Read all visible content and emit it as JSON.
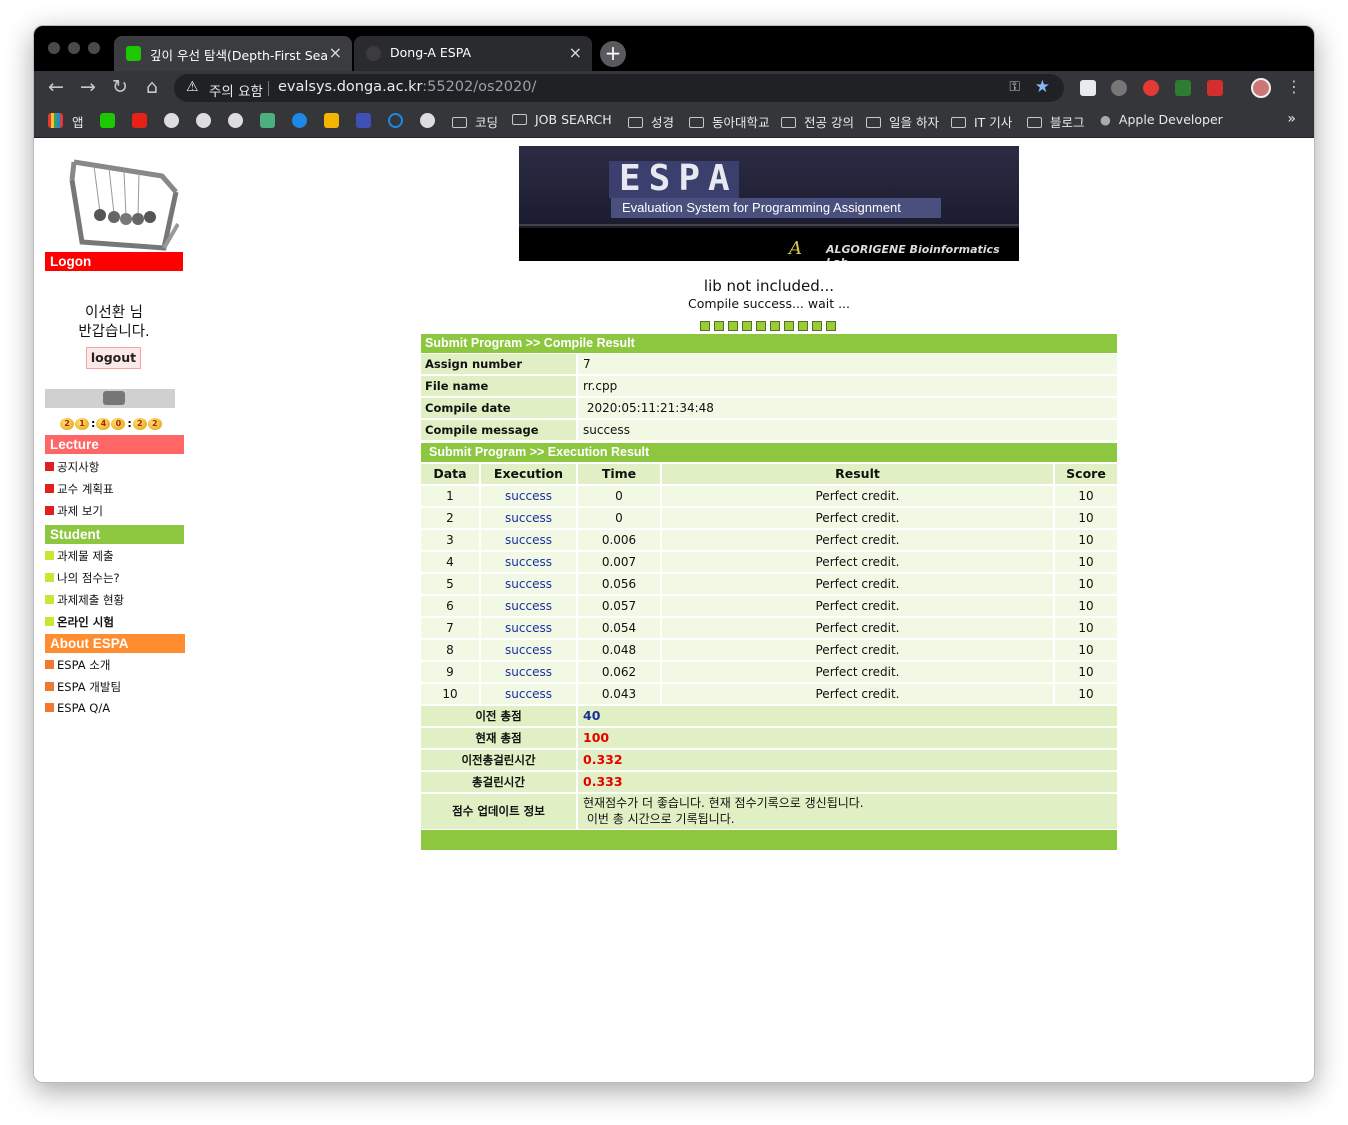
{
  "browser": {
    "tabs": [
      {
        "title": "깊이 우선 탐색(Depth-First Sear...",
        "active": false,
        "favicon": "blog-icon"
      },
      {
        "title": "Dong-A ESPA",
        "active": true,
        "favicon": "globe-icon"
      }
    ],
    "security_label": "주의 요함",
    "url_host": "evalsys.donga.ac.kr",
    "url_rest": ":55202/os2020/",
    "bookmarks": [
      {
        "label": "앱"
      },
      {
        "label": "코딩"
      },
      {
        "label": "JOB SEARCH"
      },
      {
        "label": "성경"
      },
      {
        "label": "동아대학교"
      },
      {
        "label": "전공 강의"
      },
      {
        "label": "일을 하자"
      },
      {
        "label": "IT 기사"
      },
      {
        "label": "블로그"
      },
      {
        "label": "Apple Developer"
      }
    ],
    "more": "»"
  },
  "sidebar": {
    "logon": "Logon",
    "user_name": "이선환 님",
    "welcome": "반갑습니다.",
    "logout": "logout",
    "counter": [
      "2",
      "1",
      "4",
      "0",
      "2",
      "2"
    ],
    "lecture_title": "Lecture",
    "lecture_items": [
      "공지사항",
      "교수 계획표",
      "과제 보기"
    ],
    "student_title": "Student",
    "student_items": [
      "과제물 제출",
      "나의 점수는?",
      "과제제출 현황",
      "온라인 시험"
    ],
    "about_title": "About ESPA",
    "about_items": [
      "ESPA 소개",
      "ESPA 개발팀",
      "ESPA Q/A"
    ],
    "colors": {
      "lecture": "#ff6666",
      "student": "#8dc63f",
      "about": "#ff8c2e",
      "logon": "#ff0000"
    }
  },
  "banner": {
    "title": "ESPA",
    "subtitle": "Evaluation System for Programming Assignment",
    "lab": "ALGORIGENE Bioinformatics Lab"
  },
  "status": {
    "line1": "lib not included...",
    "line2": "Compile success... wait ..."
  },
  "compile": {
    "header": "Submit Program >> Compile Result",
    "rows": [
      {
        "key": "Assign number",
        "value": "7"
      },
      {
        "key": "File name",
        "value": "rr.cpp"
      },
      {
        "key": "Compile date",
        "value": " 2020:05:11:21:34:48"
      },
      {
        "key": "Compile message",
        "value": "success"
      }
    ]
  },
  "execution": {
    "header": "Submit Program >> Execution Result",
    "columns": [
      "Data",
      "Execution",
      "Time",
      "Result",
      "Score"
    ],
    "rows": [
      [
        "1",
        "success",
        "0",
        "Perfect credit.",
        "10"
      ],
      [
        "2",
        "success",
        "0",
        "Perfect credit.",
        "10"
      ],
      [
        "3",
        "success",
        "0.006",
        "Perfect credit.",
        "10"
      ],
      [
        "4",
        "success",
        "0.007",
        "Perfect credit.",
        "10"
      ],
      [
        "5",
        "success",
        "0.056",
        "Perfect credit.",
        "10"
      ],
      [
        "6",
        "success",
        "0.057",
        "Perfect credit.",
        "10"
      ],
      [
        "7",
        "success",
        "0.054",
        "Perfect credit.",
        "10"
      ],
      [
        "8",
        "success",
        "0.048",
        "Perfect credit.",
        "10"
      ],
      [
        "9",
        "success",
        "0.062",
        "Perfect credit.",
        "10"
      ],
      [
        "10",
        "success",
        "0.043",
        "Perfect credit.",
        "10"
      ]
    ],
    "summary": [
      {
        "key": "이전 총점",
        "value": "40",
        "color": "#1a2ea0"
      },
      {
        "key": "현재 총점",
        "value": "100",
        "color": "#e60000"
      },
      {
        "key": "이전총걸린시간",
        "value": "0.332",
        "color": "#e60000"
      },
      {
        "key": "총걸린시간",
        "value": "0.333",
        "color": "#e60000"
      }
    ],
    "update_key": "점수 업데이트 정보",
    "update_line1": "현재점수가 더 좋습니다. 현재 점수기록으로 갱신됩니다.",
    "update_line2": " 이번 총 시간으로 기록됩니다."
  }
}
